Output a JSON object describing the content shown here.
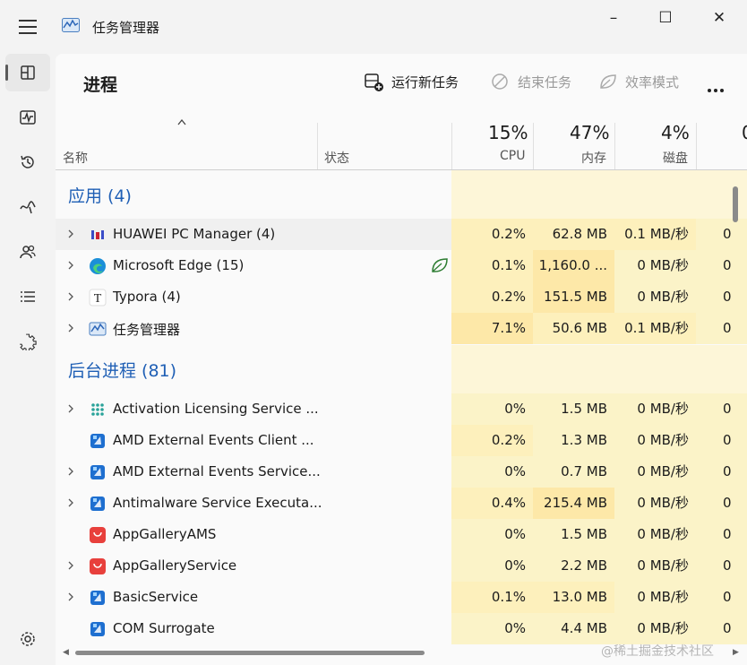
{
  "window": {
    "title": "任务管理器",
    "minimize": "–",
    "maximize": "☐",
    "close": "✕"
  },
  "toolbar": {
    "title": "进程",
    "run_new_task": "运行新任务",
    "end_task": "结束任务",
    "efficiency_mode": "效率模式"
  },
  "columns": {
    "name": "名称",
    "status": "状态",
    "cpu_pct": "15%",
    "cpu": "CPU",
    "mem_pct": "47%",
    "mem": "内存",
    "disk_pct": "4%",
    "disk": "磁盘",
    "net_pct": "0"
  },
  "groups": {
    "apps": "应用 (4)",
    "background": "后台进程 (81)"
  },
  "apps": [
    {
      "name": "HUAWEI PC Manager (4)",
      "cpu": "0.2%",
      "mem": "62.8 MB",
      "disk": "0.1 MB/秒",
      "net": "0",
      "icon": "huawei-pc-manager-icon",
      "expand": true
    },
    {
      "name": "Microsoft Edge (15)",
      "cpu": "0.1%",
      "mem": "1,160.0 ...",
      "disk": "0 MB/秒",
      "net": "0",
      "icon": "edge-icon",
      "expand": true
    },
    {
      "name": "Typora (4)",
      "cpu": "0.2%",
      "mem": "151.5 MB",
      "disk": "0 MB/秒",
      "net": "0",
      "icon": "typora-icon",
      "expand": true
    },
    {
      "name": "任务管理器",
      "cpu": "7.1%",
      "mem": "50.6 MB",
      "disk": "0.1 MB/秒",
      "net": "0",
      "icon": "task-manager-icon",
      "expand": true
    }
  ],
  "background": [
    {
      "name": "Activation Licensing Service ...",
      "cpu": "0%",
      "mem": "1.5 MB",
      "disk": "0 MB/秒",
      "net": "0",
      "icon": "activation-icon",
      "expand": true
    },
    {
      "name": "AMD External Events Client ...",
      "cpu": "0.2%",
      "mem": "1.3 MB",
      "disk": "0 MB/秒",
      "net": "0",
      "icon": "amd-icon",
      "expand": false
    },
    {
      "name": "AMD External Events Service...",
      "cpu": "0%",
      "mem": "0.7 MB",
      "disk": "0 MB/秒",
      "net": "0",
      "icon": "amd-icon",
      "expand": true
    },
    {
      "name": "Antimalware Service Executa...",
      "cpu": "0.4%",
      "mem": "215.4 MB",
      "disk": "0 MB/秒",
      "net": "0",
      "icon": "amd-icon",
      "expand": true
    },
    {
      "name": "AppGalleryAMS",
      "cpu": "0%",
      "mem": "1.5 MB",
      "disk": "0 MB/秒",
      "net": "0",
      "icon": "appgallery-icon",
      "expand": false
    },
    {
      "name": "AppGalleryService",
      "cpu": "0%",
      "mem": "2.2 MB",
      "disk": "0 MB/秒",
      "net": "0",
      "icon": "appgallery-icon",
      "expand": true
    },
    {
      "name": "BasicService",
      "cpu": "0.1%",
      "mem": "13.0 MB",
      "disk": "0 MB/秒",
      "net": "0",
      "icon": "amd-icon",
      "expand": true
    },
    {
      "name": "COM Surrogate",
      "cpu": "0%",
      "mem": "4.4 MB",
      "disk": "0 MB/秒",
      "net": "0",
      "icon": "amd-icon",
      "expand": false
    }
  ],
  "watermark": "@稀土掘金技术社区",
  "colors": {
    "group_title": "#1f5fb5",
    "heat_light": "#fbf3c8",
    "heat_mid": "#fde8a8"
  }
}
